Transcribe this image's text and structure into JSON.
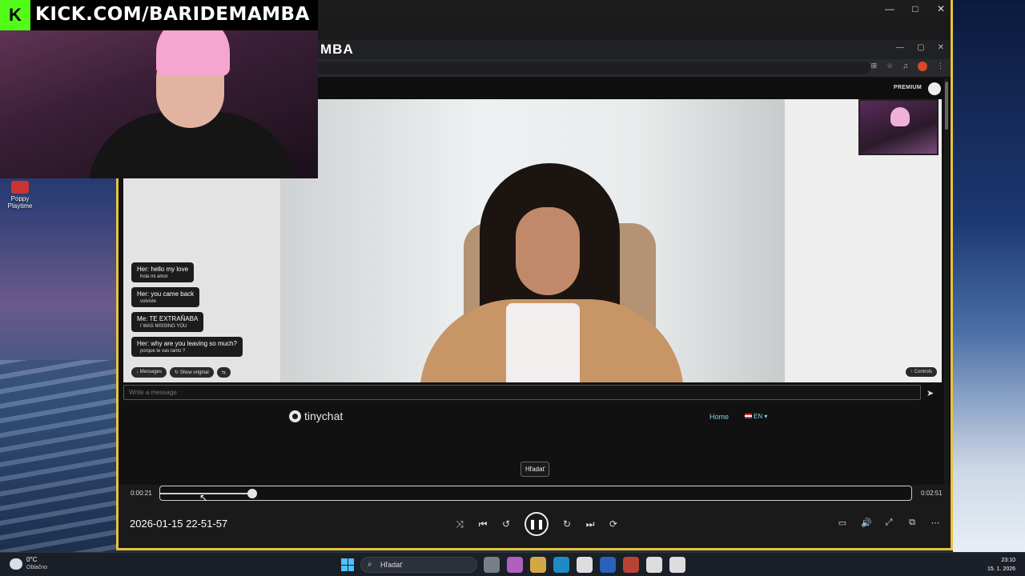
{
  "desktop": {
    "icons": [
      {
        "label": "Poppy Playtime"
      }
    ]
  },
  "stream_overlay": {
    "kick_letter": "K",
    "channel": "KICK.COM/BARIDEMAMBA"
  },
  "player_window": {
    "controls": [
      "minimize",
      "maximize",
      "close"
    ]
  },
  "browser": {
    "logo_partial": "MBA",
    "site": {
      "premium_label": "PREMIUM",
      "chat_messages": [
        {
          "main": "Her: hello my love",
          "sub": "hola mi amor"
        },
        {
          "main": "Her: you came back",
          "sub": "volviste"
        },
        {
          "main": "Me: TE EXTRAÑABA",
          "sub": "I WAS MISSING YOU"
        },
        {
          "main": "Her: why are you leaving so much?",
          "sub": "porque te vas tanto ?"
        }
      ],
      "chat_tools": {
        "messages": "↓ Messages",
        "show_original": "↻ Show original",
        "swap": "⇆"
      },
      "controls_chip": "↑ Controls",
      "message_placeholder": "Write a message",
      "footer": {
        "logo_text": "tinychat",
        "home_link": "Home",
        "language": "EN ▾"
      }
    }
  },
  "player": {
    "tooltip": "Hľadať",
    "time_elapsed": "0:00:21",
    "time_total": "0:02:51",
    "progress_fraction": 0.1228,
    "title_timestamp": "2026-01-15 22-51-57"
  },
  "taskbar": {
    "weather_temp": "0°C",
    "weather_desc": "Oblačno",
    "search_text": "Hľadať",
    "time": "23:10",
    "date": "15. 1. 2026",
    "app_colors": [
      "#8a8f98",
      "#c86cd6",
      "#f2c14e",
      "#1fa0e0",
      "#ffffff",
      "#2a6fd6",
      "#d24a3a",
      "#ffffff",
      "#ffffff"
    ]
  }
}
